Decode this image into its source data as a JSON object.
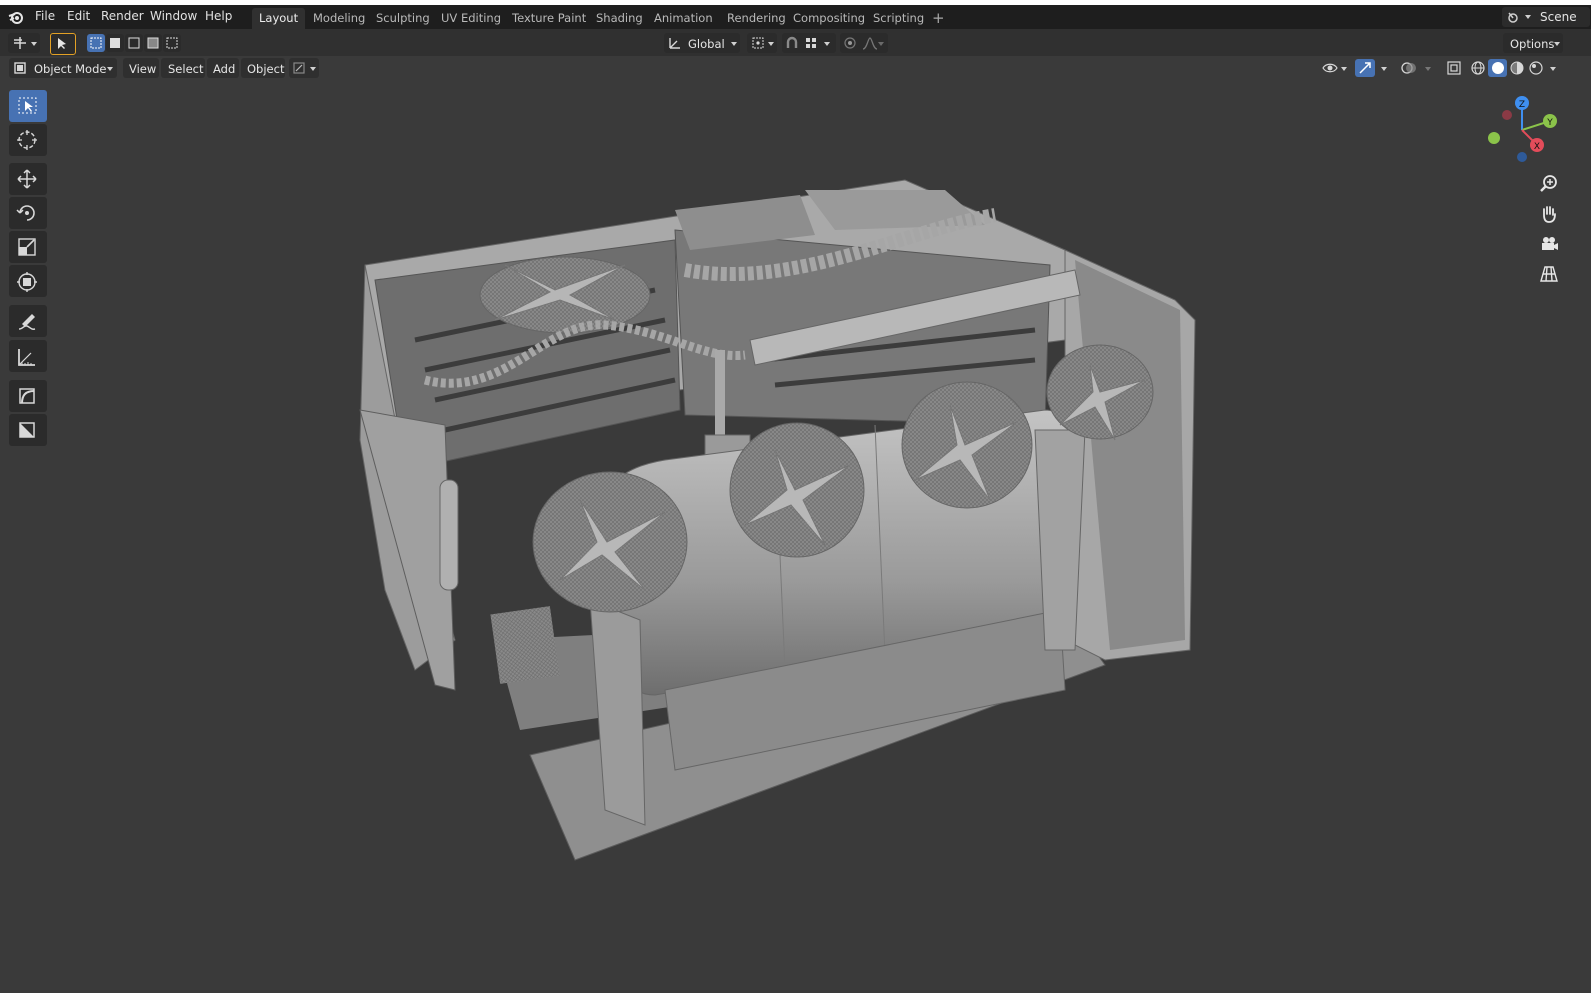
{
  "menu": [
    "File",
    "Edit",
    "Render",
    "Window",
    "Help"
  ],
  "workspace_tabs": [
    "Layout",
    "Modeling",
    "Sculpting",
    "UV Editing",
    "Texture Paint",
    "Shading",
    "Animation",
    "Rendering",
    "Compositing",
    "Scripting"
  ],
  "active_tab": "Layout",
  "scene_label": "Scene",
  "header": {
    "transform_orientation": "Global",
    "options_label": "Options"
  },
  "viewport_header": {
    "mode": "Object Mode",
    "menus": [
      "View",
      "Select",
      "Add",
      "Object"
    ]
  },
  "gizmo_axes": {
    "z": "Z",
    "y": "Y",
    "x": "X"
  },
  "colors": {
    "accent": "#4772b3",
    "axis_x": "#e34c5a",
    "axis_y": "#8bc34a",
    "axis_z": "#3f8ff0",
    "background": "#3a3a3a"
  },
  "toolbar_icons": [
    "select-box-icon",
    "cursor-icon",
    "move-icon",
    "rotate-icon",
    "scale-icon",
    "transform-icon",
    "annotate-icon",
    "measure-icon",
    "add-cube-icon",
    "add-plane-icon"
  ],
  "nav_icons": [
    "zoom-icon",
    "pan-hand-icon",
    "camera-icon",
    "grid-view-icon"
  ]
}
